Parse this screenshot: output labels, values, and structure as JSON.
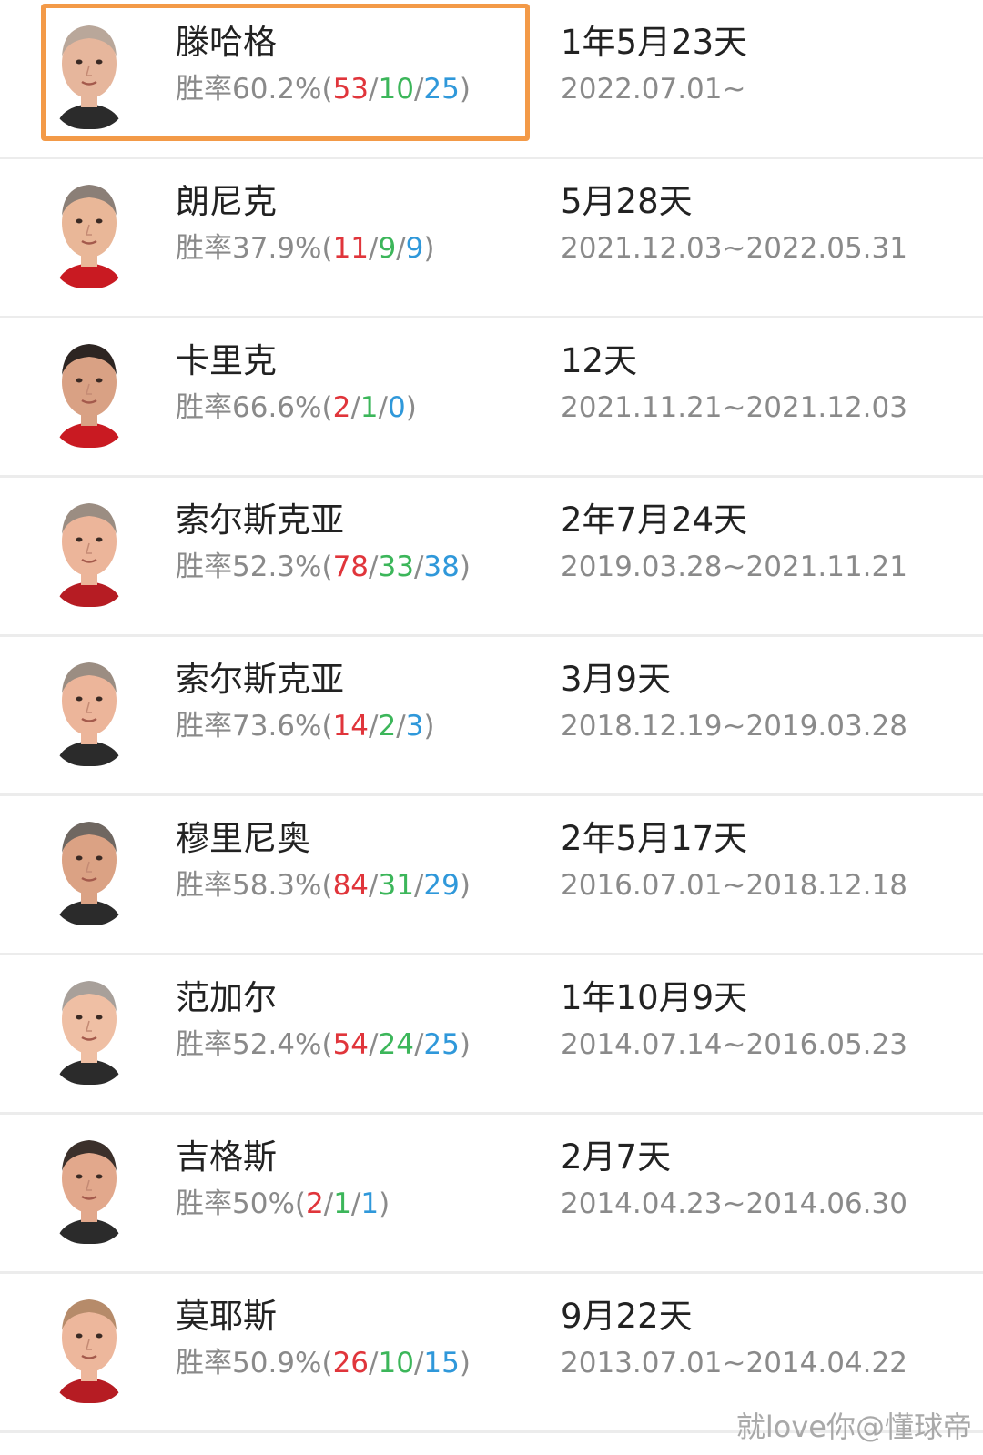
{
  "managers": [
    {
      "name": "滕哈格",
      "stats_prefix": "胜率60.2%(",
      "wins": "53",
      "draws": "10",
      "losses": "25",
      "stats_suffix": ")",
      "tenure": "1年5月23天",
      "range": "2022.07.01~",
      "hair": "#b9a79a",
      "skin": "#e6b69c",
      "shirt": "#2b2b2b"
    },
    {
      "name": "朗尼克",
      "stats_prefix": "胜率37.9%(",
      "wins": "11",
      "draws": "9",
      "losses": "9",
      "stats_suffix": ")",
      "tenure": "5月28天",
      "range": "2021.12.03~2022.05.31",
      "hair": "#8b7f77",
      "skin": "#e9b798",
      "shirt": "#c91a22"
    },
    {
      "name": "卡里克",
      "stats_prefix": "胜率66.6%(",
      "wins": "2",
      "draws": "1",
      "losses": "0",
      "stats_suffix": ")",
      "tenure": "12天",
      "range": "2021.11.21~2021.12.03",
      "hair": "#2d2522",
      "skin": "#d9a184",
      "shirt": "#c91a22"
    },
    {
      "name": "索尔斯克亚",
      "stats_prefix": "胜率52.3%(",
      "wins": "78",
      "draws": "33",
      "losses": "38",
      "stats_suffix": ")",
      "tenure": "2年7月24天",
      "range": "2019.03.28~2021.11.21",
      "hair": "#9b8d82",
      "skin": "#ecb59a",
      "shirt": "#b61c23"
    },
    {
      "name": "索尔斯克亚",
      "stats_prefix": "胜率73.6%(",
      "wins": "14",
      "draws": "2",
      "losses": "3",
      "stats_suffix": ")",
      "tenure": "3月9天",
      "range": "2018.12.19~2019.03.28",
      "hair": "#9b8d82",
      "skin": "#ecb59a",
      "shirt": "#2b2b2b"
    },
    {
      "name": "穆里尼奥",
      "stats_prefix": "胜率58.3%(",
      "wins": "84",
      "draws": "31",
      "losses": "29",
      "stats_suffix": ")",
      "tenure": "2年5月17天",
      "range": "2016.07.01~2018.12.18",
      "hair": "#6f6761",
      "skin": "#dba284",
      "shirt": "#2b2b2b"
    },
    {
      "name": "范加尔",
      "stats_prefix": "胜率52.4%(",
      "wins": "54",
      "draws": "24",
      "losses": "25",
      "stats_suffix": ")",
      "tenure": "1年10月9天",
      "range": "2014.07.14~2016.05.23",
      "hair": "#a8a09a",
      "skin": "#efbfa4",
      "shirt": "#2b2b2b"
    },
    {
      "name": "吉格斯",
      "stats_prefix": "胜率50%(",
      "wins": "2",
      "draws": "1",
      "losses": "1",
      "stats_suffix": ")",
      "tenure": "2月7天",
      "range": "2014.04.23~2014.06.30",
      "hair": "#3b302b",
      "skin": "#e2a88c",
      "shirt": "#2b2b2b"
    },
    {
      "name": "莫耶斯",
      "stats_prefix": "胜率50.9%(",
      "wins": "26",
      "draws": "10",
      "losses": "15",
      "stats_suffix": ")",
      "tenure": "9月22天",
      "range": "2013.07.01~2014.04.22",
      "hair": "#b68b6a",
      "skin": "#edb79c",
      "shirt": "#b61c23"
    }
  ],
  "separator": "/",
  "watermark": "就love你@懂球帝",
  "colors": {
    "win": "#e0353b",
    "draw": "#3cb65a",
    "loss": "#2f98da",
    "highlight": "#f39a48"
  }
}
